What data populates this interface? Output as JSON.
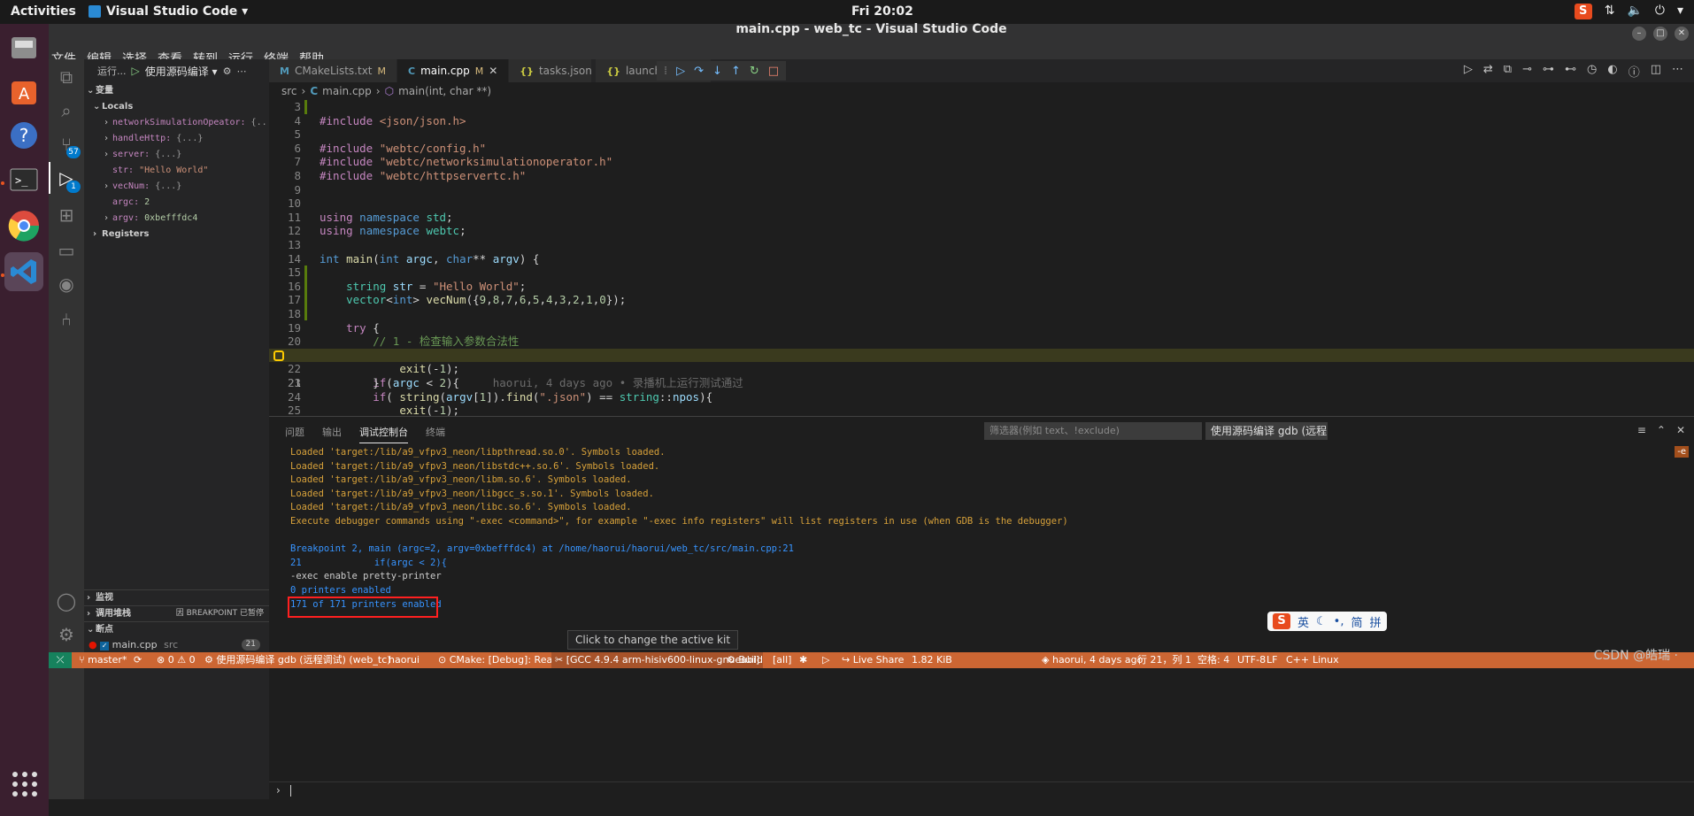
{
  "system_bar": {
    "activities": "Activities",
    "app_name": "Visual Studio Code ▾",
    "clock": "Fri 20:02"
  },
  "window": {
    "title": "main.cpp - web_tc - Visual Studio Code"
  },
  "menu": [
    "文件",
    "编辑",
    "选择",
    "查看",
    "转到",
    "运行",
    "终端",
    "帮助"
  ],
  "activity_badges": {
    "source_control": "57",
    "debug": "1"
  },
  "sidebar": {
    "run_label": "运行...",
    "config_select": "使用源码编译 ▾",
    "variables_title": "变量",
    "locals_title": "Locals",
    "locals": [
      {
        "name": "networkSimulationOpeator:",
        "value": "{...}",
        "expandable": true
      },
      {
        "name": "handleHttp:",
        "value": "{...}",
        "expandable": true
      },
      {
        "name": "server:",
        "value": "{...}",
        "expandable": true
      },
      {
        "name": "str:",
        "value": "\"Hello World\"",
        "expandable": false
      },
      {
        "name": "vecNum:",
        "value": "{...}",
        "expandable": true
      },
      {
        "name": "argc:",
        "value": "2",
        "expandable": false
      },
      {
        "name": "argv:",
        "value": "0xbefffdc4",
        "expandable": true
      }
    ],
    "registers_title": "Registers",
    "watch_title": "监视",
    "callstack_title": "调用堆栈",
    "callstack_status": "因 BREAKPOINT 已暂停",
    "breakpoints_title": "断点",
    "breakpoint_file": "main.cpp",
    "breakpoint_dir": "src",
    "breakpoint_line": "21"
  },
  "tabs": [
    {
      "label": "CMakeLists.txt",
      "icon": "M",
      "modified": "M",
      "active": false
    },
    {
      "label": "main.cpp",
      "icon": "C",
      "modified": "M",
      "active": true
    },
    {
      "label": "tasks.json",
      "icon": "{}",
      "modified": "",
      "active": false
    },
    {
      "label": "launch.json",
      "icon": "{}",
      "modified": "M",
      "active": false
    }
  ],
  "breadcrumb": {
    "folder": "src",
    "file": "main.cpp",
    "symbol": "main(int, char **)"
  },
  "editor": {
    "blame": "haorui, 4 days ago • 录播机上运行测试通过"
  },
  "panel": {
    "tabs": [
      "问题",
      "输出",
      "调试控制台",
      "终端"
    ],
    "filter_placeholder": "筛选器(例如 text、!exclude)",
    "config_select": "使用源码编译 gdb (远程",
    "console": [
      {
        "text": "Loaded 'target:/lib/a9_vfpv3_neon/libpthread.so.0'. Symbols loaded.",
        "color": "orange"
      },
      {
        "text": "Loaded 'target:/lib/a9_vfpv3_neon/libstdc++.so.6'. Symbols loaded.",
        "color": "orange"
      },
      {
        "text": "Loaded 'target:/lib/a9_vfpv3_neon/libm.so.6'. Symbols loaded.",
        "color": "orange"
      },
      {
        "text": "Loaded 'target:/lib/a9_vfpv3_neon/libgcc_s.so.1'. Symbols loaded.",
        "color": "orange"
      },
      {
        "text": "Loaded 'target:/lib/a9_vfpv3_neon/libc.so.6'. Symbols loaded.",
        "color": "orange"
      },
      {
        "text": "Execute debugger commands using \"-exec <command>\", for example \"-exec info registers\" will list registers in use (when GDB is the debugger)",
        "color": "orange"
      },
      {
        "text": "",
        "color": "white"
      },
      {
        "text": "Breakpoint 2, main (argc=2, argv=0xbefffdc4) at /home/haorui/haorui/web_tc/src/main.cpp:21",
        "color": "blue"
      },
      {
        "text": "21             if(argc < 2){",
        "color": "blue"
      },
      {
        "text": "-exec enable pretty-printer",
        "color": "white"
      },
      {
        "text": "0 printers enabled",
        "color": "blue"
      },
      {
        "text": "171 of 171 printers enabled",
        "color": "blue"
      }
    ],
    "e_badge": "-e"
  },
  "tooltip": "Click to change the active kit",
  "ime": {
    "lang": "英",
    "simplified": "简",
    "pinyin": "拼"
  },
  "watermark": "CSDN @皓瑞 ·",
  "statusbar": {
    "branch": "master*",
    "sync": "⟳",
    "errors": "⊗ 0 ⚠ 0",
    "debug_config": "使用源码编译 gdb (远程调试) (web_tc)",
    "user": "haorui",
    "cmake": "CMake: [Debug]: Ready",
    "kit": "[GCC 4.9.4 arm-hisiv600-linux-gnueabi]",
    "build": "Build",
    "target": "[all]",
    "live_share": "Live Share",
    "size": "1.82 KiB",
    "blame": "haorui, 4 days ago",
    "position": "行 21，列 1",
    "spaces": "空格: 4",
    "encoding": "UTF-8",
    "eol": "LF",
    "language": "C++",
    "platform": "Linux"
  }
}
